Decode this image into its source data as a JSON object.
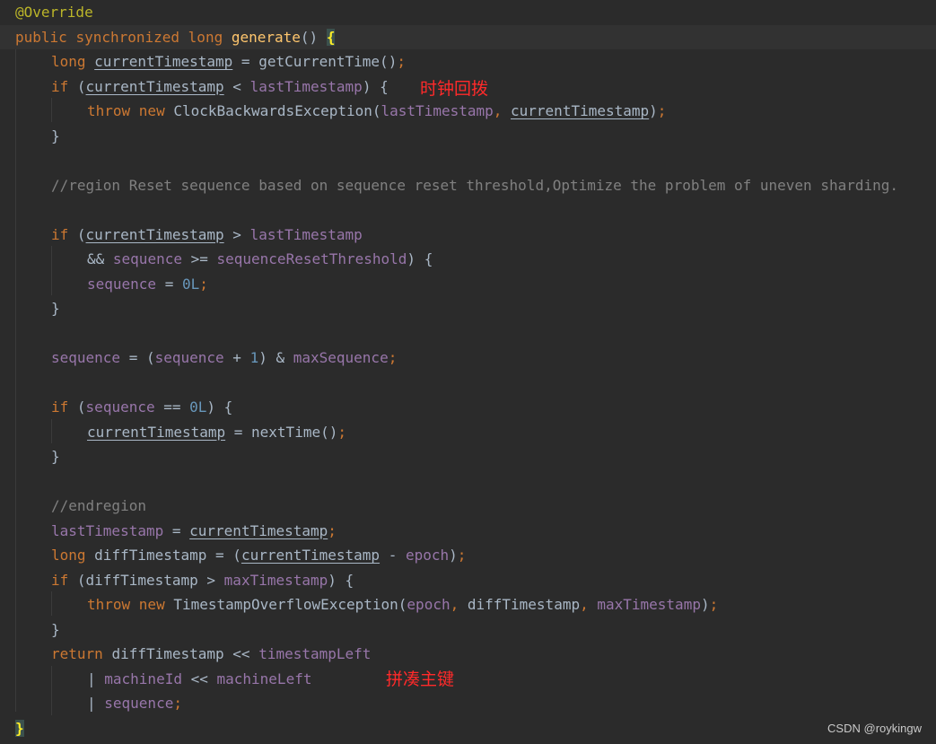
{
  "editor": {
    "lines": [
      {
        "indent": 0,
        "tokens": [
          {
            "t": "@Override",
            "c": "ann"
          }
        ]
      },
      {
        "indent": 0,
        "current": true,
        "tokens": [
          {
            "t": "public ",
            "c": "kw"
          },
          {
            "t": "synchronized ",
            "c": "kw"
          },
          {
            "t": "long ",
            "c": "kw"
          },
          {
            "t": "generate",
            "c": "fn"
          },
          {
            "t": "() "
          },
          {
            "t": "{",
            "c": "brace-hl"
          }
        ]
      },
      {
        "indent": 1,
        "tokens": [
          {
            "t": "long ",
            "c": "kw"
          },
          {
            "t": "currentTimestamp",
            "c": "var"
          },
          {
            "t": " = getCurrentTime()"
          },
          {
            "t": ";",
            "c": "punc"
          }
        ]
      },
      {
        "indent": 1,
        "tokens": [
          {
            "t": "if ",
            "c": "kw"
          },
          {
            "t": "("
          },
          {
            "t": "currentTimestamp",
            "c": "var"
          },
          {
            "t": " < "
          },
          {
            "t": "lastTimestamp",
            "c": "fld"
          },
          {
            "t": ") {"
          }
        ]
      },
      {
        "indent": 2,
        "tokens": [
          {
            "t": "throw ",
            "c": "kw"
          },
          {
            "t": "new ",
            "c": "kw"
          },
          {
            "t": "ClockBackwardsException("
          },
          {
            "t": "lastTimestamp",
            "c": "fld"
          },
          {
            "t": ", ",
            "c": "punc"
          },
          {
            "t": "currentTimestamp",
            "c": "var"
          },
          {
            "t": ")"
          },
          {
            "t": ";",
            "c": "punc"
          }
        ]
      },
      {
        "indent": 1,
        "tokens": [
          {
            "t": "}"
          }
        ]
      },
      {
        "indent": 0,
        "tokens": []
      },
      {
        "indent": 1,
        "tokens": [
          {
            "t": "//region Reset sequence based on sequence reset threshold,Optimize the problem of uneven sharding.",
            "c": "cmt"
          }
        ]
      },
      {
        "indent": 0,
        "tokens": []
      },
      {
        "indent": 1,
        "tokens": [
          {
            "t": "if ",
            "c": "kw"
          },
          {
            "t": "("
          },
          {
            "t": "currentTimestamp",
            "c": "var"
          },
          {
            "t": " > "
          },
          {
            "t": "lastTimestamp",
            "c": "fld"
          }
        ]
      },
      {
        "indent": 2,
        "tokens": [
          {
            "t": "&& "
          },
          {
            "t": "sequence",
            "c": "fld"
          },
          {
            "t": " >= "
          },
          {
            "t": "sequenceResetThreshold",
            "c": "fld"
          },
          {
            "t": ") {"
          }
        ]
      },
      {
        "indent": 2,
        "tokens": [
          {
            "t": "sequence",
            "c": "fld"
          },
          {
            "t": " = "
          },
          {
            "t": "0L",
            "c": "num"
          },
          {
            "t": ";",
            "c": "punc"
          }
        ]
      },
      {
        "indent": 1,
        "tokens": [
          {
            "t": "}"
          }
        ]
      },
      {
        "indent": 0,
        "tokens": []
      },
      {
        "indent": 1,
        "tokens": [
          {
            "t": "sequence",
            "c": "fld"
          },
          {
            "t": " = ("
          },
          {
            "t": "sequence",
            "c": "fld"
          },
          {
            "t": " + "
          },
          {
            "t": "1",
            "c": "num"
          },
          {
            "t": ") & "
          },
          {
            "t": "maxSequence",
            "c": "fld"
          },
          {
            "t": ";",
            "c": "punc"
          }
        ]
      },
      {
        "indent": 0,
        "tokens": []
      },
      {
        "indent": 1,
        "tokens": [
          {
            "t": "if ",
            "c": "kw"
          },
          {
            "t": "("
          },
          {
            "t": "sequence",
            "c": "fld"
          },
          {
            "t": " == "
          },
          {
            "t": "0L",
            "c": "num"
          },
          {
            "t": ") {"
          }
        ]
      },
      {
        "indent": 2,
        "tokens": [
          {
            "t": "currentTimestamp",
            "c": "var"
          },
          {
            "t": " = nextTime()"
          },
          {
            "t": ";",
            "c": "punc"
          }
        ]
      },
      {
        "indent": 1,
        "tokens": [
          {
            "t": "}"
          }
        ]
      },
      {
        "indent": 0,
        "tokens": []
      },
      {
        "indent": 1,
        "tokens": [
          {
            "t": "//endregion",
            "c": "cmt"
          }
        ]
      },
      {
        "indent": 1,
        "tokens": [
          {
            "t": "lastTimestamp",
            "c": "fld"
          },
          {
            "t": " = "
          },
          {
            "t": "currentTimestamp",
            "c": "var"
          },
          {
            "t": ";",
            "c": "punc"
          }
        ]
      },
      {
        "indent": 1,
        "tokens": [
          {
            "t": "long ",
            "c": "kw"
          },
          {
            "t": "diffTimestamp = ("
          },
          {
            "t": "currentTimestamp",
            "c": "var"
          },
          {
            "t": " - "
          },
          {
            "t": "epoch",
            "c": "fld"
          },
          {
            "t": ")"
          },
          {
            "t": ";",
            "c": "punc"
          }
        ]
      },
      {
        "indent": 1,
        "tokens": [
          {
            "t": "if ",
            "c": "kw"
          },
          {
            "t": "(diffTimestamp > "
          },
          {
            "t": "maxTimestamp",
            "c": "fld"
          },
          {
            "t": ") {"
          }
        ]
      },
      {
        "indent": 2,
        "tokens": [
          {
            "t": "throw ",
            "c": "kw"
          },
          {
            "t": "new ",
            "c": "kw"
          },
          {
            "t": "TimestampOverflowException("
          },
          {
            "t": "epoch",
            "c": "fld"
          },
          {
            "t": ", ",
            "c": "punc"
          },
          {
            "t": "diffTimestamp"
          },
          {
            "t": ", ",
            "c": "punc"
          },
          {
            "t": "maxTimestamp",
            "c": "fld"
          },
          {
            "t": ")"
          },
          {
            "t": ";",
            "c": "punc"
          }
        ]
      },
      {
        "indent": 1,
        "tokens": [
          {
            "t": "}"
          }
        ]
      },
      {
        "indent": 1,
        "tokens": [
          {
            "t": "return ",
            "c": "kw"
          },
          {
            "t": "diffTimestamp << "
          },
          {
            "t": "timestampLeft",
            "c": "fld"
          }
        ]
      },
      {
        "indent": 2,
        "tokens": [
          {
            "t": "| "
          },
          {
            "t": "machineId",
            "c": "fld"
          },
          {
            "t": " << "
          },
          {
            "t": "machineLeft",
            "c": "fld"
          }
        ]
      },
      {
        "indent": 2,
        "tokens": [
          {
            "t": "| "
          },
          {
            "t": "sequence",
            "c": "fld"
          },
          {
            "t": ";",
            "c": "punc"
          }
        ]
      },
      {
        "indent": 0,
        "tokens": [
          {
            "t": "}",
            "c": "brace-hl-end"
          }
        ]
      }
    ]
  },
  "annotations": {
    "clock_backwards": "时钟回拨",
    "compose_key": "拼凑主键"
  },
  "watermark": "CSDN @roykingw"
}
